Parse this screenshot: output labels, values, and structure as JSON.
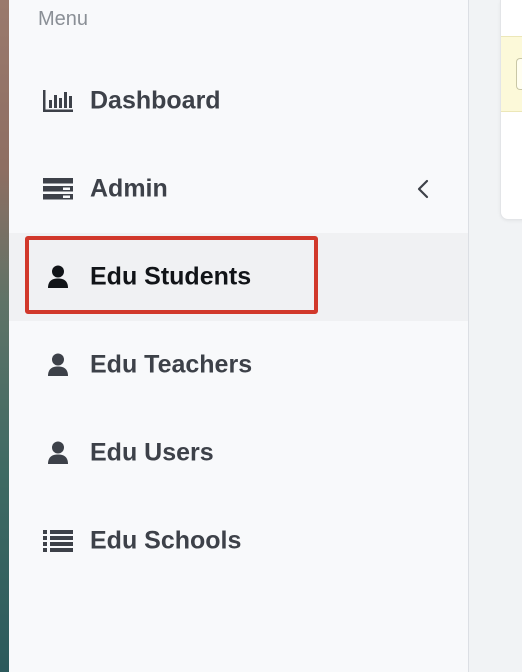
{
  "sidebar": {
    "menu_label": "Menu",
    "items": [
      {
        "label": "Dashboard",
        "icon": "bar-chart-icon"
      },
      {
        "label": "Admin",
        "icon": "server-icon",
        "chevron": "chevron-left-icon"
      },
      {
        "label": "Edu Students",
        "icon": "user-icon",
        "active": true
      },
      {
        "label": "Edu Teachers",
        "icon": "user-icon"
      },
      {
        "label": "Edu Users",
        "icon": "user-icon"
      },
      {
        "label": "Edu Schools",
        "icon": "list-icon"
      }
    ]
  },
  "colors": {
    "highlight_border": "#d1382b",
    "active_background": "#f0f1f3",
    "text": "#3d4149",
    "muted_text": "#8a8f96"
  }
}
